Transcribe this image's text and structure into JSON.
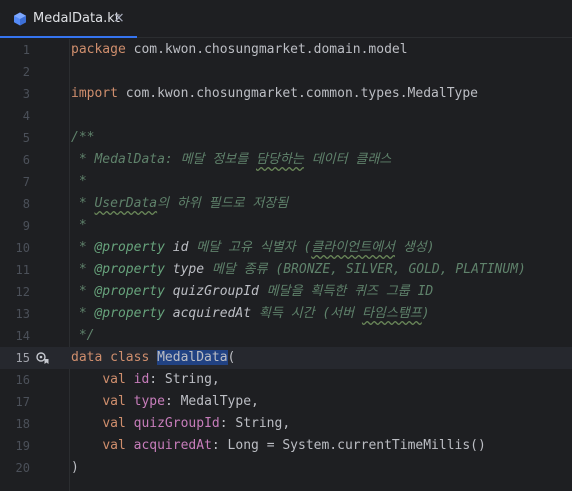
{
  "tab": {
    "filename": "MedalData.kt",
    "close_glyph": "×",
    "icon": "kotlin-file-icon",
    "accent_color": "#3574f0"
  },
  "editor": {
    "current_line": 15,
    "gutter_icon_line15": "class-implementation-icon",
    "lines": [
      {
        "n": "1",
        "segments": [
          [
            "kw",
            "package"
          ],
          [
            "pl",
            " com.kwon.chosungmarket.domain.model"
          ]
        ]
      },
      {
        "n": "2",
        "segments": []
      },
      {
        "n": "3",
        "segments": [
          [
            "kw",
            "import"
          ],
          [
            "pl",
            " com.kwon.chosungmarket.common.types.MedalType"
          ]
        ]
      },
      {
        "n": "4",
        "segments": []
      },
      {
        "n": "5",
        "segments": [
          [
            "doc",
            "/**"
          ]
        ]
      },
      {
        "n": "6",
        "segments": [
          [
            "doc",
            " * MedalData: 메달 정보를 "
          ],
          [
            "docsq",
            "담당하는"
          ],
          [
            "doc",
            " 데이터 클래스"
          ]
        ]
      },
      {
        "n": "7",
        "segments": [
          [
            "doc",
            " *"
          ]
        ]
      },
      {
        "n": "8",
        "segments": [
          [
            "doc",
            " * "
          ],
          [
            "docsq",
            "UserData"
          ],
          [
            "doc",
            "의 하위 필드로 저장됨"
          ]
        ]
      },
      {
        "n": "9",
        "segments": [
          [
            "doc",
            " *"
          ]
        ]
      },
      {
        "n": "10",
        "segments": [
          [
            "doc",
            " * "
          ],
          [
            "doctag",
            "@property"
          ],
          [
            "docparam",
            " id"
          ],
          [
            "doc",
            " 메달 고유 식별자 ("
          ],
          [
            "docsq",
            "클라이언트에서"
          ],
          [
            "doc",
            " 생성)"
          ]
        ]
      },
      {
        "n": "11",
        "segments": [
          [
            "doc",
            " * "
          ],
          [
            "doctag",
            "@property"
          ],
          [
            "docparam",
            " type"
          ],
          [
            "doc",
            " 메달 종류 (BRONZE, SILVER, GOLD, PLATINUM)"
          ]
        ]
      },
      {
        "n": "12",
        "segments": [
          [
            "doc",
            " * "
          ],
          [
            "doctag",
            "@property"
          ],
          [
            "docparam",
            " quizGroupId"
          ],
          [
            "doc",
            " 메달을 획득한 퀴즈 그룹 ID"
          ]
        ]
      },
      {
        "n": "13",
        "segments": [
          [
            "doc",
            " * "
          ],
          [
            "doctag",
            "@property"
          ],
          [
            "docparam",
            " acquiredAt"
          ],
          [
            "doc",
            " 획득 시간 (서버 "
          ],
          [
            "docsq",
            "타임스탬프"
          ],
          [
            "doc",
            ")"
          ]
        ]
      },
      {
        "n": "14",
        "segments": [
          [
            "doc",
            " */"
          ]
        ]
      },
      {
        "n": "15",
        "segments": [
          [
            "kw",
            "data class "
          ],
          [
            "cls",
            "MedalData"
          ],
          [
            "paren",
            "("
          ]
        ]
      },
      {
        "n": "16",
        "segments": [
          [
            "pl",
            "    "
          ],
          [
            "kw",
            "val "
          ],
          [
            "prop",
            "id"
          ],
          [
            "pl",
            ": String,"
          ]
        ]
      },
      {
        "n": "17",
        "segments": [
          [
            "pl",
            "    "
          ],
          [
            "kw",
            "val "
          ],
          [
            "prop",
            "type"
          ],
          [
            "pl",
            ": MedalType,"
          ]
        ]
      },
      {
        "n": "18",
        "segments": [
          [
            "pl",
            "    "
          ],
          [
            "kw",
            "val "
          ],
          [
            "prop",
            "quizGroupId"
          ],
          [
            "pl",
            ": String,"
          ]
        ]
      },
      {
        "n": "19",
        "segments": [
          [
            "pl",
            "    "
          ],
          [
            "kw",
            "val "
          ],
          [
            "prop",
            "acquiredAt"
          ],
          [
            "pl",
            ": Long = System.currentTimeMillis()"
          ]
        ]
      },
      {
        "n": "20",
        "segments": [
          [
            "paren",
            ")"
          ]
        ]
      }
    ]
  }
}
